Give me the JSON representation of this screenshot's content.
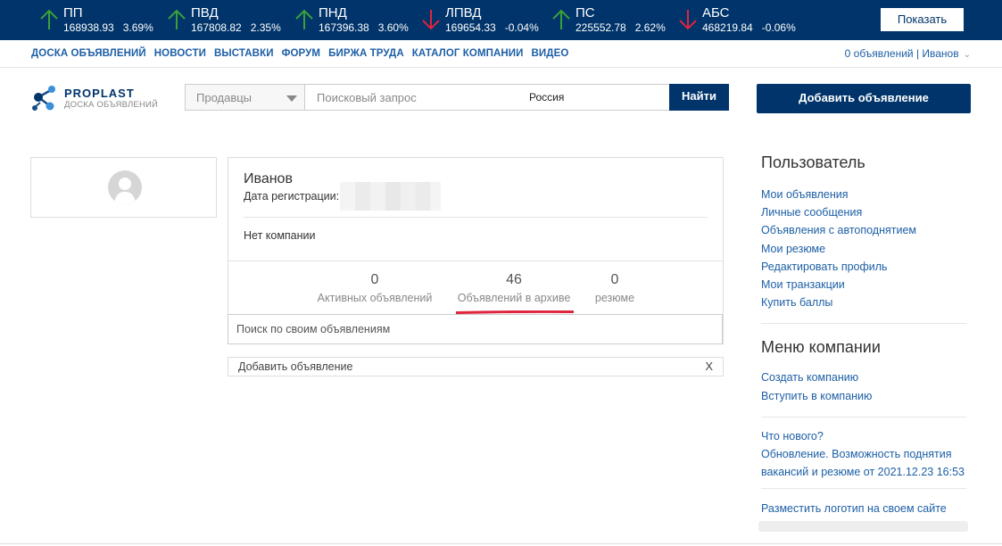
{
  "ticker": {
    "items": [
      {
        "name": "ПП",
        "price": "168938.93",
        "change": "3.69%",
        "dir": "up"
      },
      {
        "name": "ПВД",
        "price": "167808.82",
        "change": "2.35%",
        "dir": "up"
      },
      {
        "name": "ПНД",
        "price": "167396.38",
        "change": "3.60%",
        "dir": "up"
      },
      {
        "name": "ЛПВД",
        "price": "169654.33",
        "change": "-0.04%",
        "dir": "down"
      },
      {
        "name": "ПС",
        "price": "225552.78",
        "change": "2.62%",
        "dir": "up"
      },
      {
        "name": "АБС",
        "price": "468219.84",
        "change": "-0.06%",
        "dir": "down"
      }
    ],
    "show_label": "Показать",
    "up_color": "#3aa13a",
    "down_color": "#e0243e"
  },
  "nav": {
    "links": [
      "ДОСКА ОБЪЯВЛЕНИЙ",
      "НОВОСТИ",
      "ВЫСТАВКИ",
      "ФОРУМ",
      "БИРЖА ТРУДА",
      "КАТАЛОГ КОМПАНИИ",
      "ВИДЕО"
    ],
    "user": "0 объявлений | Иванов"
  },
  "logo": {
    "brand": "PROPLAST",
    "sub": "ДОСКА ОБЪЯВЛЕНИЙ"
  },
  "search": {
    "category": "Продавцы",
    "placeholder": "Поисковый запрос",
    "region": "Россия",
    "button": "Найти"
  },
  "add_ad_button": "Добавить объявление",
  "profile": {
    "name": "Иванов",
    "reg_label": "Дата регистрации:",
    "company": "Нет компании",
    "stats": [
      {
        "value": "0",
        "label": "Активных объявлений"
      },
      {
        "value": "46",
        "label": "Объявлений в архиве"
      },
      {
        "value": "0",
        "label": "резюме"
      }
    ],
    "own_search_placeholder": "Поиск по своим объявлениям",
    "add_strip": "Добавить объявление",
    "close": "X"
  },
  "sidebar": {
    "user_title": "Пользователь",
    "user_links": [
      "Мои объявления",
      "Личные сообщения",
      "Объявления с автоподнятием",
      "Мои резюме",
      "Редактировать профиль",
      "Мои транзакции",
      "Купить баллы"
    ],
    "company_title": "Меню компании",
    "company_links": [
      "Создать компанию",
      "Вступить в компанию"
    ],
    "news_title": "Что нового?",
    "news_text": "Обновление. Возможность поднятия вакансий и резюме от 2021.12.23 16:53",
    "logo_link": "Разместить логотип на своем сайте"
  }
}
